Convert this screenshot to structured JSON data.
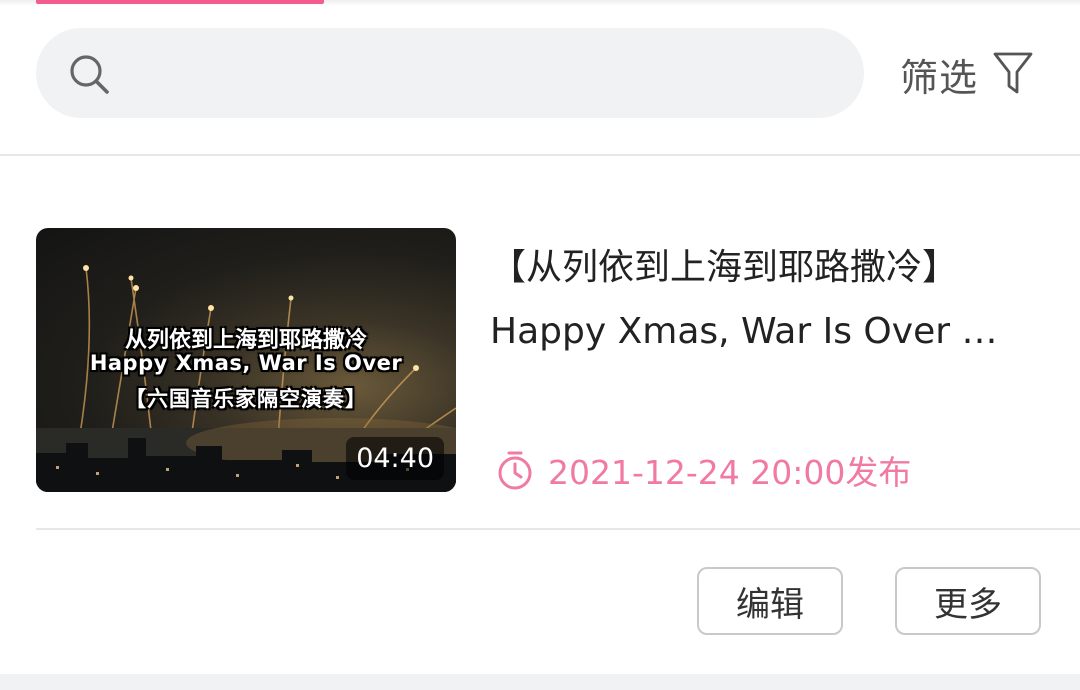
{
  "header": {
    "search": {
      "placeholder": "",
      "value": ""
    },
    "filter_label": "筛选"
  },
  "video": {
    "thumbnail": {
      "overlay_lines": [
        "从列依到上海到耶路撒冷",
        "Happy Xmas, War Is Over",
        "【六国音乐家隔空演奏】"
      ],
      "duration": "04:40"
    },
    "title_lines": [
      "【从列依到上海到耶路撒冷】",
      "Happy Xmas, War Is Over …"
    ],
    "publish_text": "2021-12-24 20:00发布"
  },
  "actions": {
    "edit_label": "编辑",
    "more_label": "更多"
  },
  "icons": {
    "search": "search-icon",
    "filter": "funnel-icon",
    "clock": "timer-icon"
  },
  "colors": {
    "accent": "#f25d8e",
    "publish_text": "#f07aa3",
    "search_bg": "#f1f2f3"
  }
}
